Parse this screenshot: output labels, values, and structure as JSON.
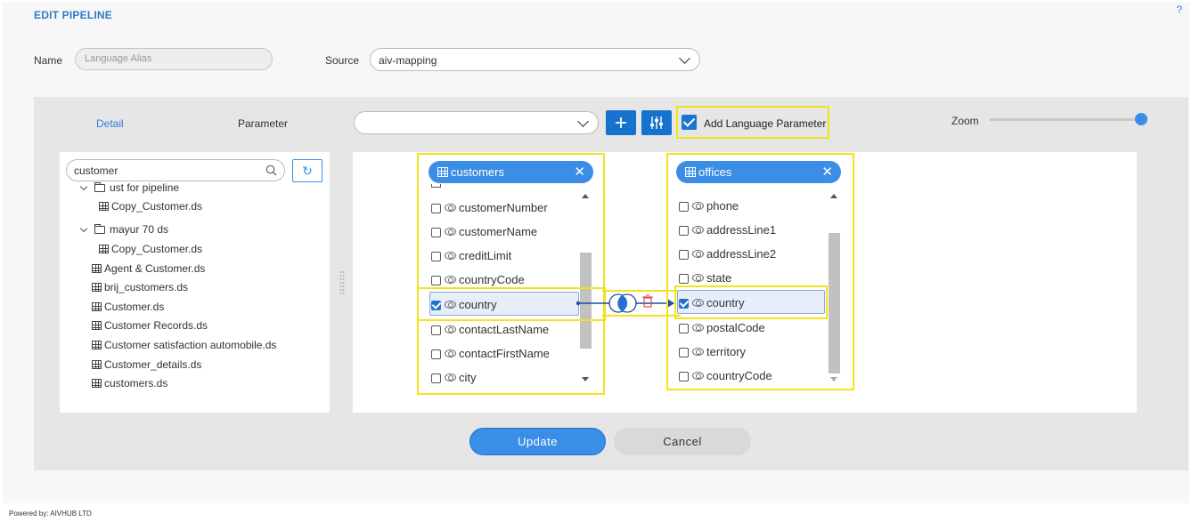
{
  "page": {
    "title": "EDIT PIPELINE",
    "help": "?"
  },
  "form": {
    "name_label": "Name",
    "name_placeholder": "Language Alias",
    "source_label": "Source",
    "source_value": "aiv-mapping"
  },
  "tabs": {
    "detail": "Detail",
    "parameter": "Parameter"
  },
  "toolbar": {
    "param_select_value": "",
    "add_icon": "plus-icon",
    "settings_icon": "sliders-icon",
    "add_language_label": "Add Language Parameter",
    "add_language_checked": true,
    "zoom_label": "Zoom",
    "zoom_level": 1.0
  },
  "tree": {
    "search_value": "customer",
    "items": [
      {
        "label": "ust for pipeline",
        "type": "folder"
      },
      {
        "label": "Copy_Customer.ds",
        "type": "table"
      },
      {
        "label": "mayur 70 ds",
        "type": "folder"
      },
      {
        "label": "Copy_Customer.ds",
        "type": "table"
      },
      {
        "label": "Agent & Customer.ds",
        "type": "table"
      },
      {
        "label": "brij_customers.ds",
        "type": "table"
      },
      {
        "label": "Customer.ds",
        "type": "table"
      },
      {
        "label": "Customer Records.ds",
        "type": "table"
      },
      {
        "label": "Customer satisfaction automobile.ds",
        "type": "table"
      },
      {
        "label": "Customer_details.ds",
        "type": "table"
      },
      {
        "label": "customers.ds",
        "type": "table"
      }
    ]
  },
  "nodes": {
    "left": {
      "title": "customers",
      "fields": [
        {
          "label": "customerNumber",
          "checked": false
        },
        {
          "label": "customerName",
          "checked": false
        },
        {
          "label": "creditLimit",
          "checked": false
        },
        {
          "label": "countryCode",
          "checked": false
        },
        {
          "label": "country",
          "checked": true
        },
        {
          "label": "contactLastName",
          "checked": false
        },
        {
          "label": "contactFirstName",
          "checked": false
        },
        {
          "label": "city",
          "checked": false
        }
      ]
    },
    "right": {
      "title": "offices",
      "fields": [
        {
          "label": "phone",
          "checked": false
        },
        {
          "label": "addressLine1",
          "checked": false
        },
        {
          "label": "addressLine2",
          "checked": false
        },
        {
          "label": "state",
          "checked": false
        },
        {
          "label": "country",
          "checked": true
        },
        {
          "label": "postalCode",
          "checked": false
        },
        {
          "label": "territory",
          "checked": false
        },
        {
          "label": "countryCode",
          "checked": false
        }
      ]
    }
  },
  "join": {
    "type_icon": "inner-join-icon",
    "delete_icon": "trash-icon",
    "color": "#1e4aa8"
  },
  "actions": {
    "update": "Update",
    "cancel": "Cancel"
  },
  "footer": "Powered by: AIVHUB LTD",
  "colors": {
    "accent": "#3a8ee6",
    "primary": "#1573cf",
    "highlight": "#f2e31b"
  }
}
